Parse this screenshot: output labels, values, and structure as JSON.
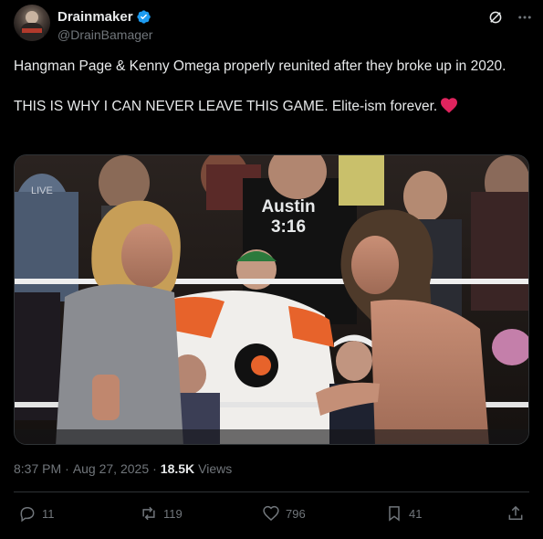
{
  "author": {
    "display_name": "Drainmaker",
    "handle": "@DrainBamager",
    "verified_color": "#1d9bf0"
  },
  "tweet": {
    "line1": "Hangman Page & Kenny Omega properly reunited after they broke up in 2020.",
    "line2": "THIS IS WHY I CAN NEVER LEAVE THIS GAME. Elite-ism forever.",
    "emoji": "red-heart"
  },
  "media": {
    "shirt_text_line1": "Austin",
    "shirt_text_line2": "3:16",
    "banner_text": "LIVE"
  },
  "meta": {
    "time": "8:37 PM",
    "separator": "·",
    "date": "Aug 27, 2025",
    "views_count": "18.5K",
    "views_label": "Views"
  },
  "actions": {
    "replies": "11",
    "reposts": "119",
    "likes": "796",
    "bookmarks": "41"
  },
  "colors": {
    "background": "#000000",
    "text": "#e7e9ea",
    "secondary": "#71767b",
    "divider": "#2f3336",
    "heart": "#f91880"
  }
}
